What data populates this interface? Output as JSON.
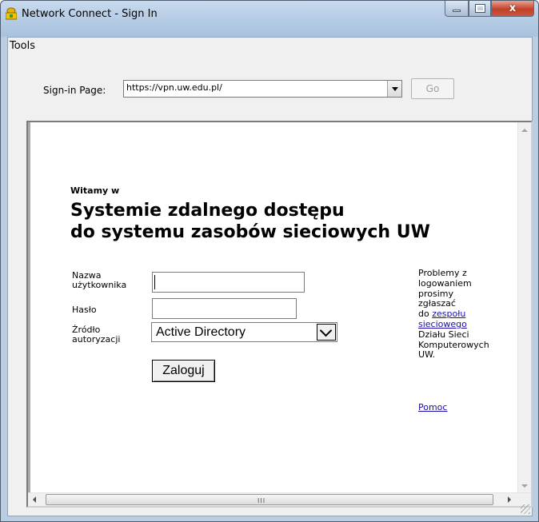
{
  "window": {
    "title": "Network Connect - Sign In",
    "controls": {
      "minimize": "",
      "maximize": "",
      "close": "x"
    }
  },
  "menubar": {
    "tools": "Tools"
  },
  "toolbar": {
    "signin_label": "Sign-in Page:",
    "url_value": "https://vpn.uw.edu.pl/",
    "go_label": "Go"
  },
  "page": {
    "welcome": "Witamy w",
    "heading_line1": "Systemie zdalnego dostępu",
    "heading_line2": "do systemu zasobów sieciowych UW",
    "username_label_1": "Nazwa",
    "username_label_2": "użytkownika",
    "username_value": "",
    "password_label": "Hasło",
    "password_value": "",
    "auth_source_label_1": "Źródło",
    "auth_source_label_2": "autoryzacji",
    "auth_source_selected": "Active Directory",
    "login_button": "Zaloguj",
    "help_lines": [
      "Problemy z",
      "logowaniem",
      "prosimy",
      "zgłaszać"
    ],
    "help_do": "do",
    "help_link_1": "zespołu",
    "help_link_2": "sieciowego",
    "help_tail": [
      "Działu Sieci",
      "Komputerowych",
      "UW."
    ],
    "help_link_pomoc": "Pomoc"
  },
  "scrollbar": {
    "grip": "III"
  },
  "colors": {
    "link": "#1a0dab",
    "titlebar": "#b9cde3",
    "close_button": "#c3412b"
  }
}
